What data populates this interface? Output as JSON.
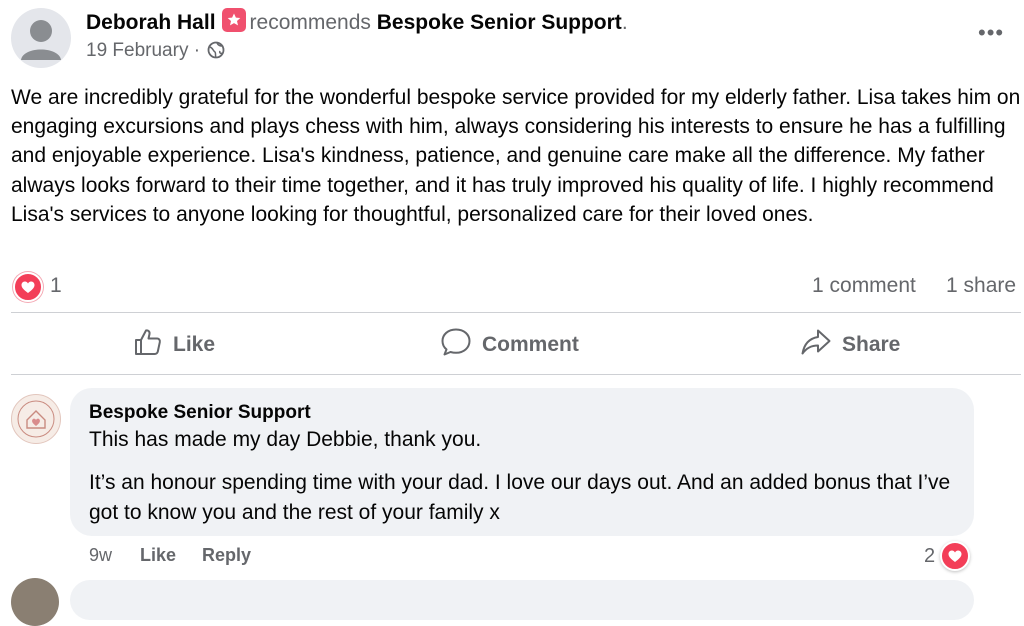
{
  "post": {
    "author": "Deborah Hall",
    "action_text": "recommends",
    "page_name": "Bespoke Senior Support",
    "page_suffix": ".",
    "date": "19 February",
    "date_separator": "·",
    "more_icon": "•••",
    "body": "We are incredibly grateful for the wonderful bespoke service provided for my elderly father. Lisa takes him on engaging excursions and plays chess with him, always considering his interests to ensure he has a fulfilling and enjoyable experience. Lisa's kindness, patience, and genuine care make all the difference. My father always looks forward to their time together, and it has truly improved his quality of life. I highly recommend Lisa's services to anyone looking for thoughtful, personalized care for their loved ones.",
    "reaction_count": "1",
    "comments_count": "1 comment",
    "shares_count": "1 share"
  },
  "actions": {
    "like_label": "Like",
    "comment_label": "Comment",
    "share_label": "Share"
  },
  "comment": {
    "author": "Bespoke Senior Support",
    "line1": "This has made my day Debbie, thank you.",
    "paragraph": "It’s an honour spending time with your dad. I love our days out. And an added bonus that I’ve got to know you and the rest of your family x",
    "age": "9w",
    "like_label": "Like",
    "reply_label": "Reply",
    "reaction_count": "2"
  },
  "colors": {
    "heart": "#f33e58",
    "recommend_badge": "#f0506e",
    "secondary_text": "#65676b",
    "bubble": "#f0f2f5"
  }
}
